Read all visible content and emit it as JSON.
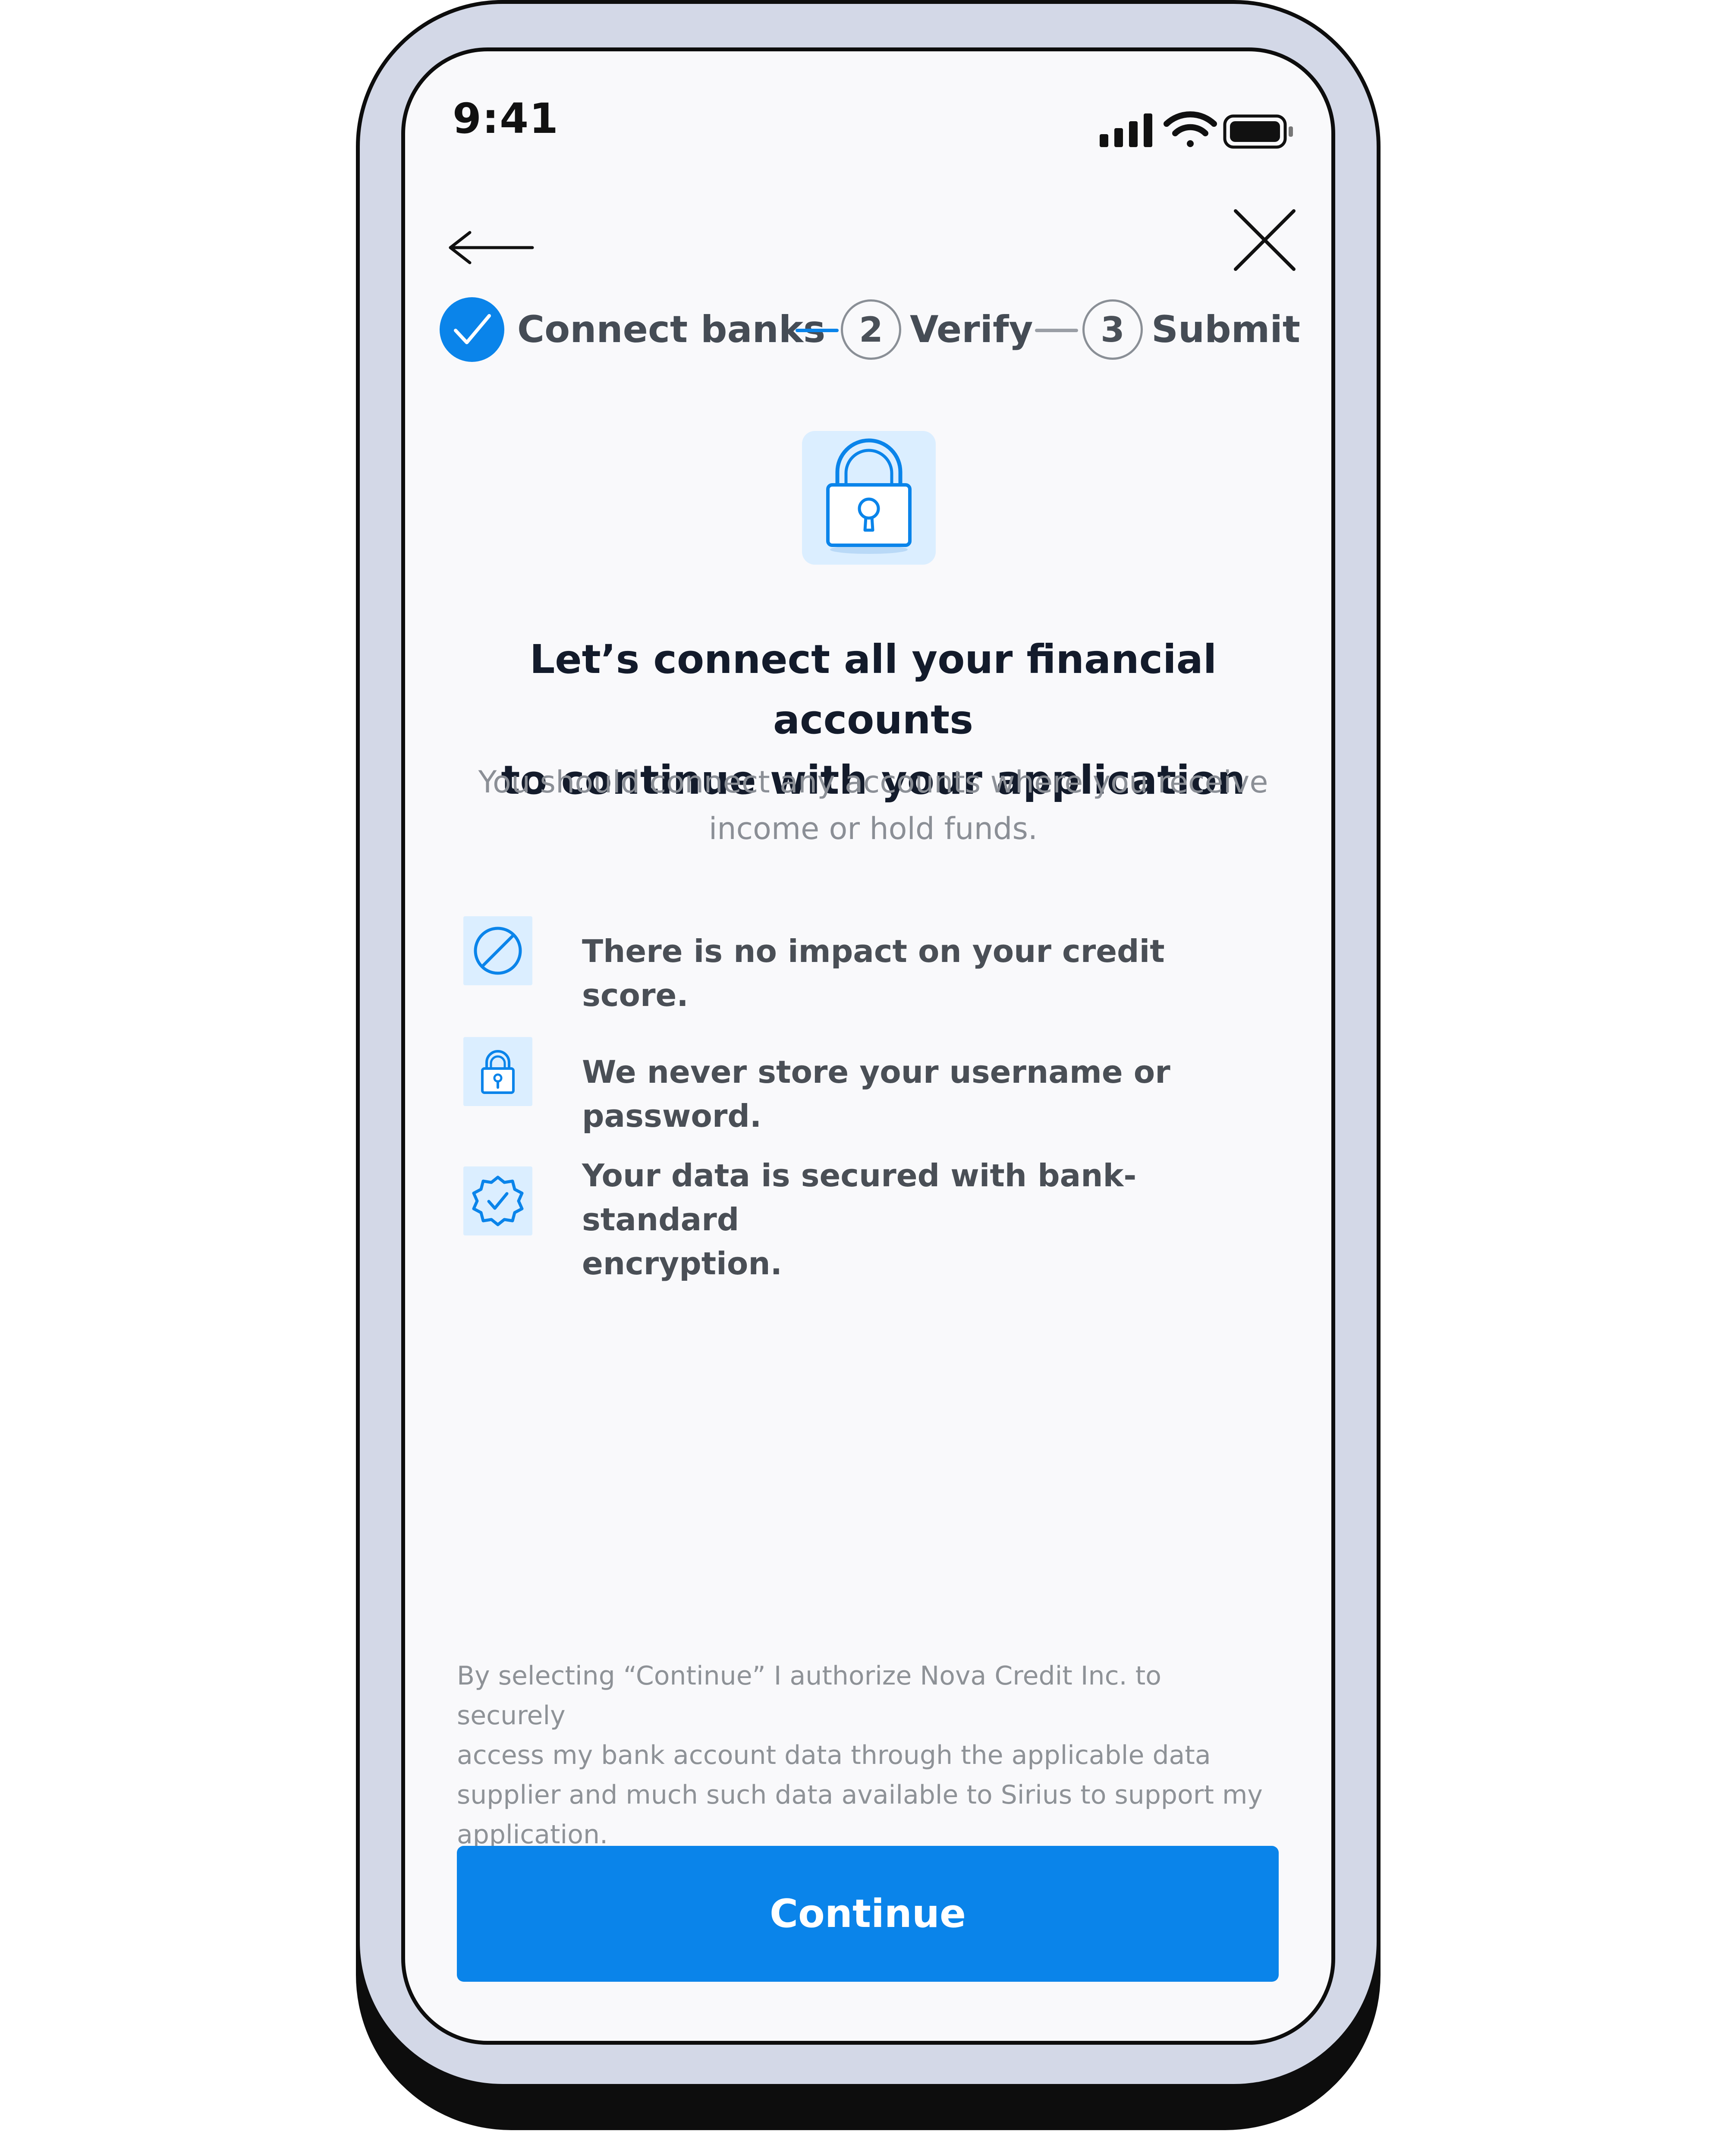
{
  "status_bar": {
    "time": "9:41",
    "icons": [
      "signal-icon",
      "wifi-icon",
      "battery-icon"
    ]
  },
  "nav": {
    "back_icon": "arrow-left-icon",
    "close_icon": "close-icon"
  },
  "stepper": {
    "steps": [
      {
        "number": "",
        "label": "Connect banks",
        "state": "completed"
      },
      {
        "number": "2",
        "label": "Verify",
        "state": "upcoming"
      },
      {
        "number": "3",
        "label": "Submit",
        "state": "upcoming"
      }
    ]
  },
  "hero": {
    "icon": "padlock-icon",
    "headline_line1": "Let’s connect all your financial accounts",
    "headline_line2": "to continue with your application",
    "subtext_line1": "You should connect any accounts where you receive",
    "subtext_line2": "income or hold funds."
  },
  "benefits": [
    {
      "icon": "no-entry-icon",
      "text": "There is no impact on your credit score."
    },
    {
      "icon": "lock-icon",
      "text": "We never store your username or password."
    },
    {
      "icon": "verified-badge-icon",
      "text_line1": "Your data is secured with bank-standard",
      "text_line2": "encryption."
    }
  ],
  "legal": {
    "line1": "By selecting “Continue” I authorize Nova Credit Inc. to securely",
    "line2": "access my bank account data through the applicable data",
    "line3": "supplier and much such data available to Sirius to support my",
    "line4": "application."
  },
  "cta": {
    "label": "Continue"
  },
  "colors": {
    "accent": "#0a84ea",
    "icon_tile": "#dbeeff",
    "frame": "#d3d8e7",
    "screen": "#f9f9fb"
  }
}
